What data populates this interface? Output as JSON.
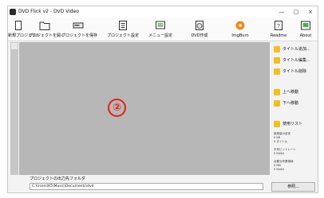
{
  "window": {
    "title": "DVD Flick v2 - DVD Video",
    "minimize": "—",
    "maximize": "□",
    "close": "×"
  },
  "toolbar": {
    "new_project": "新規プロジェクト",
    "open_project": "プロジェクトを開く",
    "save_project": "プロジェクトを保存",
    "project_settings": "プロジェクト設定",
    "menu_settings": "メニュー設定",
    "create_dvd": "DVD作成",
    "imgburn": "ImgBurn",
    "readme": "Readme",
    "about": "About"
  },
  "main": {
    "marker": "②"
  },
  "side": {
    "add_title": "タイトル追加...",
    "edit_title": "タイトル編集...",
    "remove_title": "タイトル削除",
    "move_up": "上へ移動",
    "move_down": "下へ移動",
    "used_list": "使用リスト",
    "info": [
      "使用量の目安",
      "0 KB",
      "0 タイトル",
      "",
      "平均ビットレート",
      "0 Kbit/s",
      "",
      "必要な作業領域",
      "0 MB",
      "0 Kbit/s"
    ]
  },
  "output": {
    "label": "プロジェクトの出力先フォルダ",
    "path": "C:\\Users\\K5\\Music\\Documents\\dvd",
    "browse": "参照..."
  }
}
